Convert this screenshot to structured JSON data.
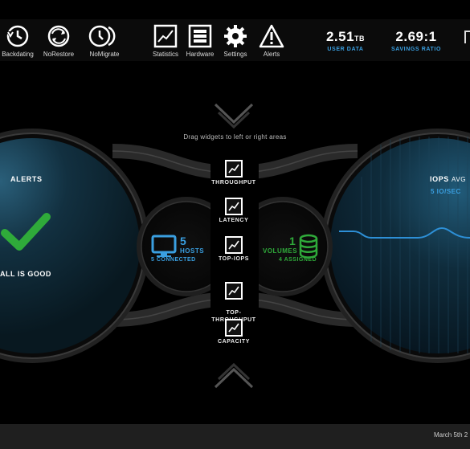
{
  "toolbar": {
    "left_items": [
      {
        "label": "Backdating",
        "icon": "clock-back-icon"
      },
      {
        "label": "NoRestore",
        "icon": "restore-icon"
      },
      {
        "label": "NoMigrate",
        "icon": "migrate-icon"
      }
    ],
    "right_items": [
      {
        "label": "Statistics",
        "icon": "chart-icon"
      },
      {
        "label": "Hardware",
        "icon": "server-icon"
      },
      {
        "label": "Settings",
        "icon": "gear-icon"
      },
      {
        "label": "Alerts",
        "icon": "warning-icon"
      }
    ],
    "user_data": {
      "value": "2.51",
      "unit": "TB",
      "label": "USER DATA"
    },
    "savings_ratio": {
      "value": "2.69:1",
      "label": "SAVINGS RATIO"
    }
  },
  "hint": "Drag widgets to left or right areas",
  "left_panel": {
    "title": "ALERTS",
    "status": "ALL IS GOOD"
  },
  "right_panel": {
    "title": "IOPS",
    "title_suffix": "AVG",
    "value": "5 IO/SEC"
  },
  "hosts": {
    "count": "5",
    "label": "HOSTS",
    "sub": "5 CONNECTED"
  },
  "volumes": {
    "count": "1",
    "label": "VOLUMES",
    "sub": "4 ASSIGNED"
  },
  "widgets": [
    {
      "label": "THROUGHPUT"
    },
    {
      "label": "LATENCY"
    },
    {
      "label": "TOP-IOPS"
    },
    {
      "label": "TOP-\nTHROUGHPUT"
    },
    {
      "label": "CAPACITY"
    }
  ],
  "footer": {
    "date": "March 5th 2"
  },
  "colors": {
    "accent_blue": "#3a9fe0",
    "green": "#2faa3a",
    "background": "#000000"
  }
}
